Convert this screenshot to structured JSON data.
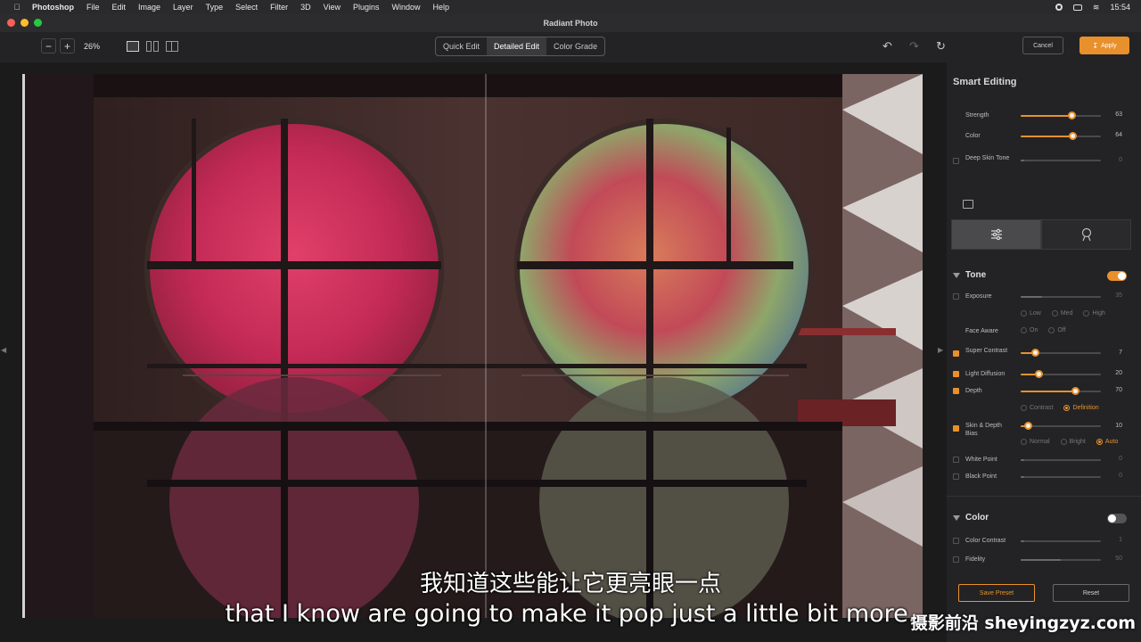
{
  "menubar": {
    "app": "Photoshop",
    "items": [
      "File",
      "Edit",
      "Image",
      "Layer",
      "Type",
      "Select",
      "Filter",
      "3D",
      "View",
      "Plugins",
      "Window",
      "Help"
    ],
    "clock": "15:54"
  },
  "window": {
    "title": "Radiant Photo"
  },
  "toolbar": {
    "zoom_out": "−",
    "zoom_in": "+",
    "zoom_level": "26%",
    "modes": [
      "Quick Edit",
      "Detailed Edit",
      "Color Grade"
    ],
    "active_mode": "Detailed Edit",
    "cancel_label": "Cancel",
    "apply_label": "Apply"
  },
  "panel": {
    "smart_title": "Smart Editing",
    "smart": [
      {
        "label": "Strength",
        "value": "63",
        "level": 0.63,
        "checked": null
      },
      {
        "label": "Color",
        "value": "64",
        "level": 0.64,
        "checked": null
      },
      {
        "label": "Deep Skin Tone",
        "value": "0",
        "level": 0,
        "checked": false
      }
    ],
    "tone": {
      "title": "Tone",
      "enabled": true,
      "exposure": {
        "label": "Exposure",
        "value": "35",
        "level": 0.27
      },
      "exposure_opts": [
        "Low",
        "Med",
        "High"
      ],
      "face_aware": {
        "label": "Face Aware",
        "opts": [
          "On",
          "Off"
        ]
      },
      "super_contrast": {
        "label": "Super Contrast",
        "value": "7",
        "level": 0.18
      },
      "light_diffusion": {
        "label": "Light Diffusion",
        "value": "20",
        "level": 0.22
      },
      "depth": {
        "label": "Depth",
        "value": "70",
        "level": 0.68
      },
      "depth_opts": [
        "Contrast",
        "Definition"
      ],
      "depth_selected": "Definition",
      "skin_depth_bias": {
        "label": "Skin & Depth Bias",
        "value": "10",
        "level": 0.09
      },
      "bias_opts": [
        "Normal",
        "Bright",
        "Auto"
      ],
      "bias_selected": "Auto",
      "white_point": {
        "label": "White Point",
        "value": "0",
        "level": 0.04
      },
      "black_point": {
        "label": "Black Point",
        "value": "0",
        "level": 0.04
      }
    },
    "color": {
      "title": "Color",
      "enabled": false,
      "color_contrast": {
        "label": "Color Contrast",
        "value": "1",
        "level": 0.04
      },
      "fidelity": {
        "label": "Fidelity",
        "value": "50",
        "level": 0.5
      }
    },
    "save_preset": "Save Preset",
    "reset": "Reset"
  },
  "subtitles": {
    "cn": "我知道这些能让它更亮眼一点",
    "en": "that I know are going to make it pop just a little bit more."
  },
  "watermark": "摄影前沿 sheyingzyz.com",
  "colors": {
    "accent": "#e8912c",
    "panel_bg": "#232325"
  }
}
